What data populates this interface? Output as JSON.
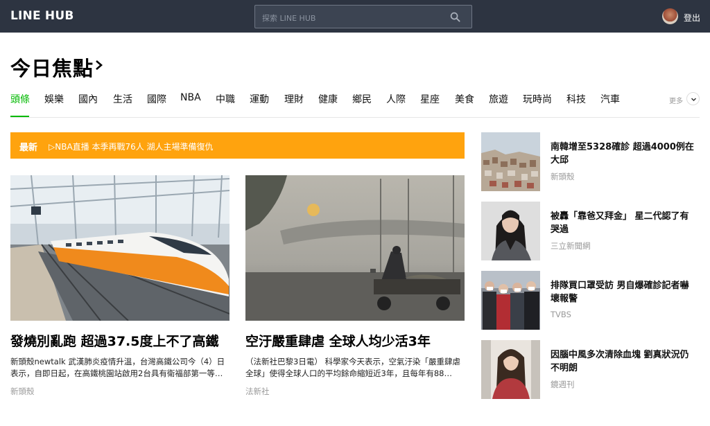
{
  "header": {
    "logo": "LINE HUB",
    "search_placeholder": "探索 LINE HUB",
    "logout_label": "登出"
  },
  "page_title": "今日焦點",
  "tabs": [
    {
      "label": "頭條",
      "active": true
    },
    {
      "label": "娛樂"
    },
    {
      "label": "國內"
    },
    {
      "label": "生活"
    },
    {
      "label": "國際"
    },
    {
      "label": "NBA"
    },
    {
      "label": "中職"
    },
    {
      "label": "運動"
    },
    {
      "label": "理財"
    },
    {
      "label": "健康"
    },
    {
      "label": "鄉民"
    },
    {
      "label": "人際"
    },
    {
      "label": "星座"
    },
    {
      "label": "美食"
    },
    {
      "label": "旅遊"
    },
    {
      "label": "玩時尚"
    },
    {
      "label": "科技"
    },
    {
      "label": "汽車"
    }
  ],
  "more_label": "更多",
  "latest": {
    "label": "最新",
    "text": "▷NBA直播 本季再戰76人 湖人主場準備復仇"
  },
  "features": [
    {
      "title": "發燒別亂跑 超過37.5度上不了高鐵",
      "desc": "新頭殼newtalk 武漢肺炎疫情升溫，台灣高鐵公司今（4）日表示，自即日起，在高鐵桃園站啟用2台具有衛福部第一等…",
      "source": "新頭殼"
    },
    {
      "title": "空汙嚴重肆虐 全球人均少活3年",
      "desc": "（法新社巴黎3日電） 科學家今天表示，空氣汙染「嚴重肆虐全球」使得全球人口的平均餘命縮短近3年，且每年有88…",
      "source": "法新社"
    }
  ],
  "side_news": [
    {
      "title": "南韓增至5328確診 超過4000例在大邱",
      "source": "新頭殼"
    },
    {
      "title": "被轟「靠爸又拜金」 星二代認了有哭過",
      "source": "三立新聞網"
    },
    {
      "title": "排隊買口罩受訪 男自爆確診記者嚇壞報警",
      "source": "TVBS"
    },
    {
      "title": "因腦中風多次清除血塊 劉真狀況仍不明朗",
      "source": "鏡週刊"
    }
  ],
  "colors": {
    "topbar": "#2d3441",
    "accent_green": "#00b900",
    "latest_orange": "#ffa30e"
  }
}
